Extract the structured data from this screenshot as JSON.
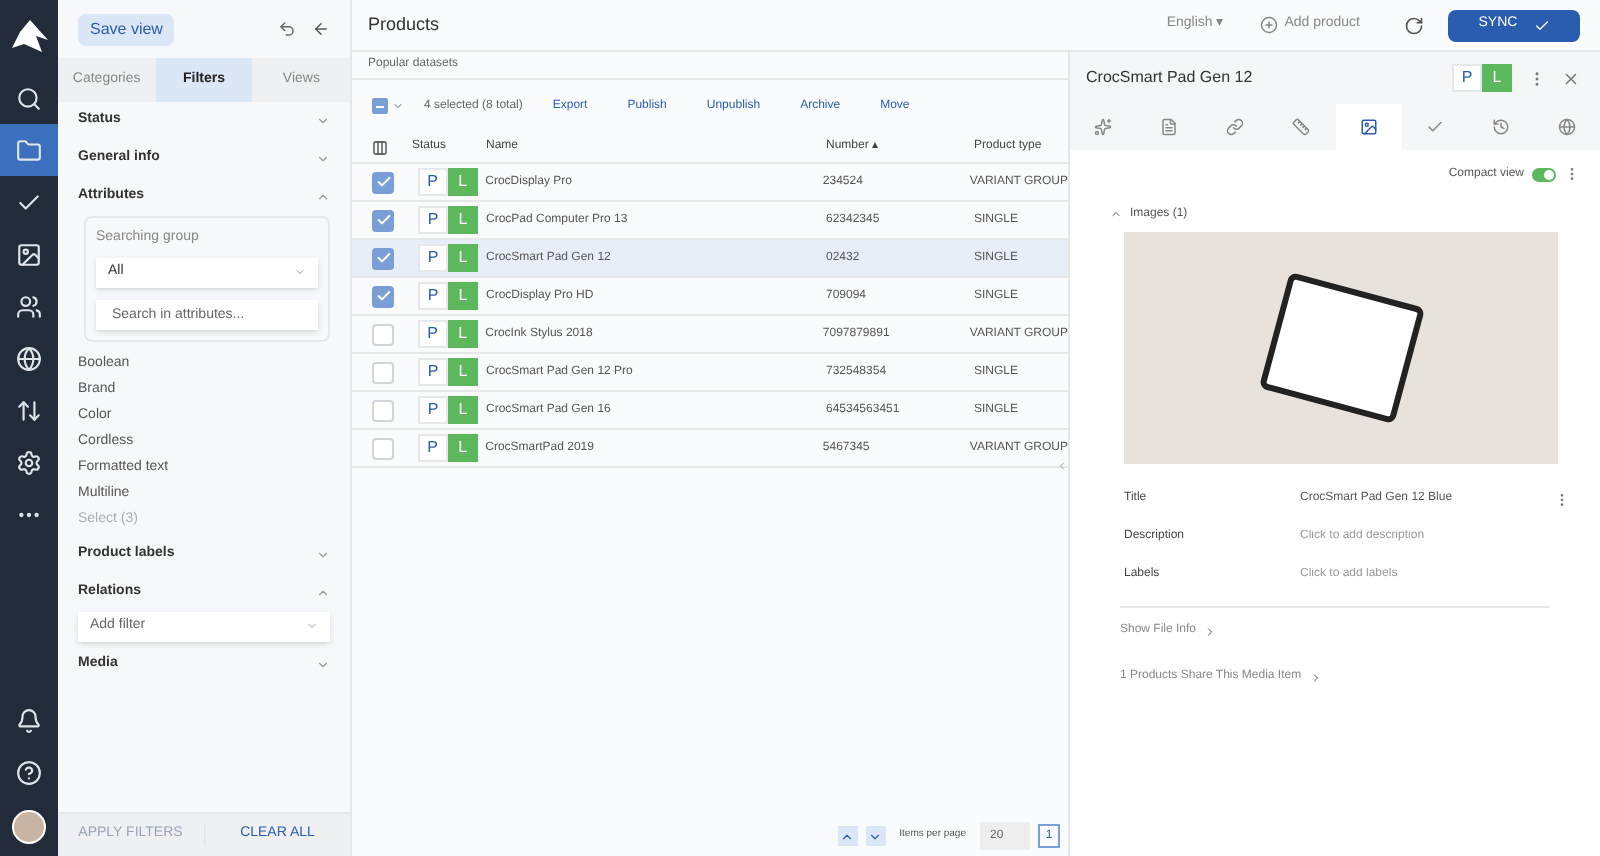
{
  "nav": {
    "items": [
      {
        "selected": false
      },
      {
        "selected": true
      },
      {
        "selected": false
      },
      {
        "selected": false
      },
      {
        "selected": false
      },
      {
        "selected": false
      },
      {
        "selected": false
      },
      {
        "selected": false
      },
      {
        "selected": false
      }
    ]
  },
  "filters": {
    "save_view": "Save view",
    "tabs": [
      {
        "label": "Categories",
        "selected": false
      },
      {
        "label": "Filters",
        "selected": true
      },
      {
        "label": "Views",
        "selected": false
      }
    ],
    "sections": [
      {
        "title": "Status",
        "expanded": false
      },
      {
        "title": "General info",
        "expanded": false
      },
      {
        "title": "Attributes",
        "expanded": true,
        "kind": "attributes",
        "group_label": "Searching group",
        "group_value": "All",
        "search_placeholder": "Search in attributes...",
        "items": [
          {
            "label": "Boolean",
            "disabled": false
          },
          {
            "label": "Brand",
            "disabled": false
          },
          {
            "label": "Color",
            "disabled": false
          },
          {
            "label": "Cordless",
            "disabled": false
          },
          {
            "label": "Formatted text",
            "disabled": false
          },
          {
            "label": "Multiline",
            "disabled": false
          },
          {
            "label": "Select (3)",
            "disabled": true
          }
        ]
      },
      {
        "title": "Product labels",
        "expanded": false
      },
      {
        "title": "Relations",
        "expanded": true,
        "kind": "select",
        "placeholder": "Add filter"
      },
      {
        "title": "Media",
        "expanded": false
      }
    ],
    "apply": {
      "label": "APPLY FILTERS",
      "disabled": true
    },
    "clear": {
      "label": "CLEAR ALL",
      "disabled": false
    }
  },
  "header": {
    "title": "Products",
    "subtitle": "Popular datasets",
    "language": "English ▾",
    "add_product": "Add product",
    "sync": "SYNC"
  },
  "toolbar": {
    "select_all_checked": true,
    "selection": "4 selected (8 total)",
    "actions": [
      "Export",
      "Publish",
      "Unpublish",
      "Archive",
      "Move"
    ]
  },
  "table": {
    "columns": [
      "Status",
      "Name",
      "Number ▴",
      "Product type"
    ],
    "rows": [
      {
        "checked": true,
        "selected": false,
        "status": [
          {
            "label": "P",
            "on": false
          },
          {
            "label": "L",
            "on": true
          }
        ],
        "name": "CrocDisplay Pro",
        "number": "234524",
        "type": "VARIANT GROUP"
      },
      {
        "checked": true,
        "selected": false,
        "status": [
          {
            "label": "P",
            "on": false
          },
          {
            "label": "L",
            "on": true
          }
        ],
        "name": "CrocPad Computer Pro 13",
        "number": "62342345",
        "type": "SINGLE"
      },
      {
        "checked": true,
        "selected": true,
        "status": [
          {
            "label": "P",
            "on": false
          },
          {
            "label": "L",
            "on": true
          }
        ],
        "name": "CrocSmart Pad Gen 12",
        "number": "02432",
        "type": "SINGLE"
      },
      {
        "checked": true,
        "selected": false,
        "status": [
          {
            "label": "P",
            "on": false
          },
          {
            "label": "L",
            "on": true
          }
        ],
        "name": "CrocDisplay Pro HD",
        "number": "709094",
        "type": "SINGLE"
      },
      {
        "checked": false,
        "selected": false,
        "status": [
          {
            "label": "P",
            "on": false
          },
          {
            "label": "L",
            "on": true
          }
        ],
        "name": "CrocInk Stylus 2018",
        "number": "7097879891",
        "type": "VARIANT GROUP"
      },
      {
        "checked": false,
        "selected": false,
        "status": [
          {
            "label": "P",
            "on": false
          },
          {
            "label": "L",
            "on": true
          }
        ],
        "name": "CrocSmart Pad Gen 12 Pro",
        "number": "732548354",
        "type": "SINGLE"
      },
      {
        "checked": false,
        "selected": false,
        "status": [
          {
            "label": "P",
            "on": false
          },
          {
            "label": "L",
            "on": true
          }
        ],
        "name": "CrocSmart Pad Gen 16",
        "number": "64534563451",
        "type": "SINGLE"
      },
      {
        "checked": false,
        "selected": false,
        "status": [
          {
            "label": "P",
            "on": false
          },
          {
            "label": "L",
            "on": true
          }
        ],
        "name": "CrocSmartPad 2019",
        "number": "5467345",
        "type": "VARIANT GROUP"
      }
    ]
  },
  "pager": {
    "label": "Items per page",
    "per_page": "20",
    "page": "1"
  },
  "detail": {
    "title": "CrocSmart Pad Gen 12",
    "status": [
      {
        "label": "P",
        "on": false
      },
      {
        "label": "L",
        "on": true
      }
    ],
    "tabs": [
      {
        "selected": false
      },
      {
        "selected": false
      },
      {
        "selected": false
      },
      {
        "selected": false
      },
      {
        "selected": true
      },
      {
        "selected": false
      },
      {
        "selected": false
      },
      {
        "selected": false
      }
    ],
    "compact_view": {
      "label": "Compact view",
      "on": true
    },
    "section": {
      "title": "Images (1)",
      "expanded": true
    },
    "fields": [
      {
        "label": "Title",
        "value": "CrocSmart Pad Gen 12 Blue"
      },
      {
        "label": "Description",
        "placeholder": "Click to add description"
      },
      {
        "label": "Labels",
        "placeholder": "Click to add labels"
      }
    ],
    "links": [
      "Show File Info",
      "1 Products Share This Media Item"
    ]
  }
}
